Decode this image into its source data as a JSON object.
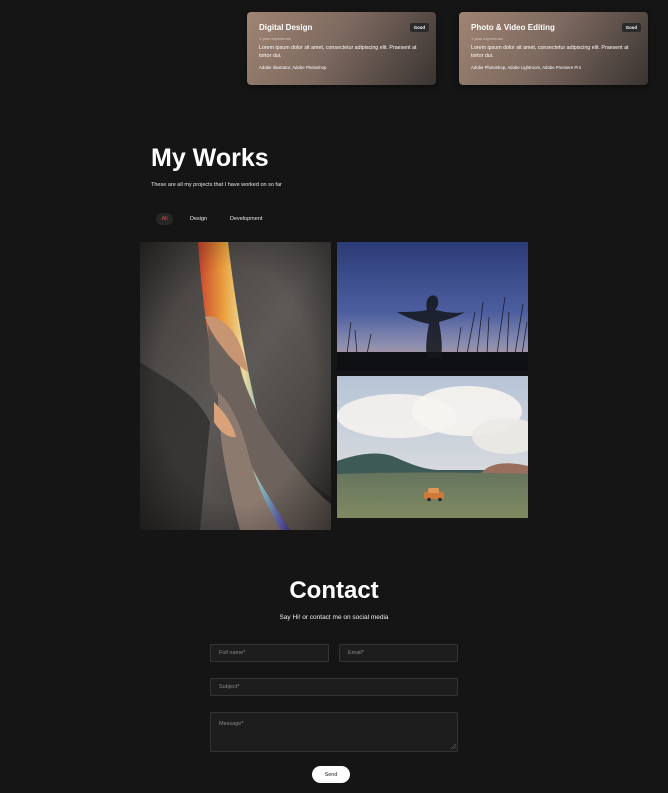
{
  "skills": {
    "cards": [
      {
        "title": "Digital Design",
        "experience": "1 year experience",
        "badge": "Good",
        "description": "Lorem ipsum dolor sit amet, consectetur adipiscing elit. Praesent at tortor dui.",
        "tools": "Adobe Illustrator, Adobe Photoshop"
      },
      {
        "title": "Photo & Video Editing",
        "experience": "1 year experience",
        "badge": "Good",
        "description": "Lorem ipsum dolor sit amet, consectetur adipiscing elit. Praesent at tortor dui.",
        "tools": "Adobe Photoshop, Adobe Lightroom, Adobe Premiere Pro"
      }
    ]
  },
  "works": {
    "title": "My Works",
    "subtitle": "These are all my projects that I have worked on so far",
    "filters": [
      "All",
      "Design",
      "Development"
    ],
    "active_filter": "All",
    "active_color": "#e0463a"
  },
  "contact": {
    "title": "Contact",
    "subtitle": "Say Hi! or contact me on social media",
    "fields": {
      "full_name_placeholder": "Full name*",
      "email_placeholder": "Email*",
      "subject_placeholder": "Subject*",
      "message_placeholder": "Message*"
    },
    "send_label": "Send"
  },
  "colors": {
    "background": "#151515",
    "card_gradient_start": "#a08472",
    "card_gradient_end": "#3a3432"
  }
}
